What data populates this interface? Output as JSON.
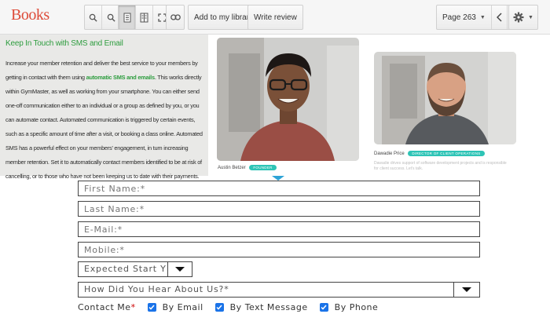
{
  "toolbar": {
    "brand": "Books",
    "add_to_library": "Add to my library",
    "write_review": "Write review",
    "page_indicator": "Page 263"
  },
  "article": {
    "heading": "Keep In Touch with SMS and Email",
    "para_1": "Increase your member retention and deliver the best service to your members by getting in contact with them using ",
    "link": "automatic SMS and emails",
    "para_2": ". This works directly within GymMaster, as well as working from your smartphone. You can either send one-off communication either to an individual or a group as defined by you, or you can automate contact. Automated communication is triggered by certain events, such as a specific amount of time after a visit, or booking a class online. Automated SMS has a powerful effect on your members' engagement, in turn increasing member retention. Set it to automatically contact members identified to be at risk of cancelling, or to those who have not been keeping us to date with their payments."
  },
  "team": {
    "person_1": {
      "name": "Austin Betzer",
      "tag": "FOUNDER"
    },
    "person_2": {
      "name": "Dawadie Price",
      "tag": "DIRECTOR OF CLIENT OPERATIONS",
      "bio": "Dawadie drives support of software development projects and is responsible for client success. Let's talk."
    }
  },
  "form": {
    "first_name": "First Name:*",
    "last_name": "Last Name:*",
    "email": "E-Mail:*",
    "mobile": "Mobile:*",
    "start": "Expected Start Y",
    "heard": "How Did You Hear About Us?*",
    "contact_label": "Contact Me",
    "contact_req": "*",
    "by_email": "By Email",
    "by_text": "By Text Message",
    "by_phone": "By Phone"
  },
  "colors": {
    "brand": "#dd4b39",
    "accent_green": "#2e9d3f",
    "tag_teal": "#2ec4b6",
    "checkbox_blue": "#1a73e8"
  }
}
